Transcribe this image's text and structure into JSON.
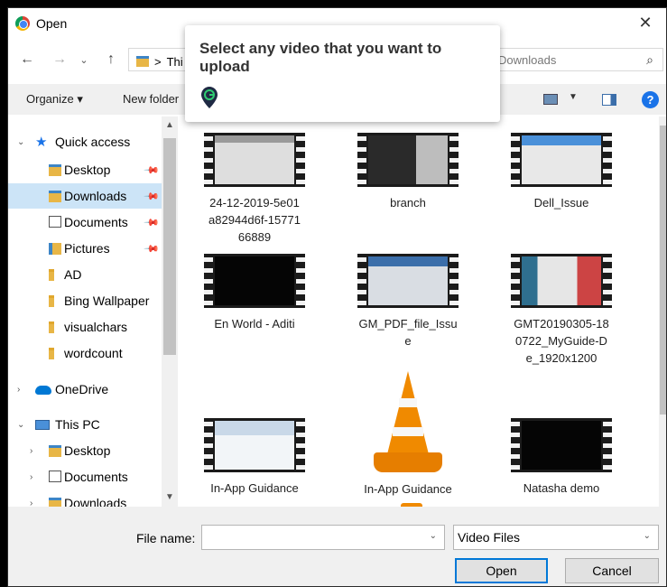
{
  "window": {
    "title": "Open",
    "close_glyph": "✕"
  },
  "address": {
    "back": "←",
    "forward": "→",
    "dropdown": "⌄",
    "up": "↑",
    "path_separator": ">",
    "path_partial": "Thi",
    "search_placeholder": "Downloads"
  },
  "toolbar": {
    "organize": "Organize ▾",
    "new_folder": "New folder",
    "help": "?"
  },
  "nav": [
    {
      "label": "Quick access",
      "icon": "star-icon"
    },
    {
      "label": "Desktop",
      "icon": "folder-icon",
      "pinned": true
    },
    {
      "label": "Downloads",
      "icon": "download-folder-icon",
      "pinned": true,
      "selected": true
    },
    {
      "label": "Documents",
      "icon": "document-icon",
      "pinned": true
    },
    {
      "label": "Pictures",
      "icon": "picture-icon",
      "pinned": true
    },
    {
      "label": "AD",
      "icon": "folder-icon"
    },
    {
      "label": "Bing Wallpaper",
      "icon": "folder-icon"
    },
    {
      "label": "visualchars",
      "icon": "folder-icon"
    },
    {
      "label": "wordcount",
      "icon": "folder-icon"
    },
    {
      "label": "OneDrive",
      "icon": "cloud-icon"
    },
    {
      "label": "This PC",
      "icon": "pc-icon"
    },
    {
      "label": "Desktop",
      "icon": "folder-icon"
    },
    {
      "label": "Documents",
      "icon": "document-icon"
    },
    {
      "label": "Downloads",
      "icon": "download-folder-icon"
    }
  ],
  "files": [
    {
      "name": "24-12-2019-5e01 a82944d6f-15771 66889",
      "lines": [
        "24-12-2019-5e01",
        "a82944d6f-15771",
        "66889"
      ],
      "kind": "video"
    },
    {
      "name": "branch",
      "lines": [
        "branch"
      ],
      "kind": "video"
    },
    {
      "name": "Dell_Issue",
      "lines": [
        "Dell_Issue"
      ],
      "kind": "video"
    },
    {
      "name": "En World - Aditi",
      "lines": [
        "En World - Aditi"
      ],
      "kind": "video"
    },
    {
      "name": "GM_PDF_file_Issue",
      "lines": [
        "GM_PDF_file_Issu",
        "e"
      ],
      "kind": "video"
    },
    {
      "name": "GMT20190305-180722_MyGuide-De_1920x1200",
      "lines": [
        "GMT20190305-18",
        "0722_MyGuide-D",
        "e_1920x1200"
      ],
      "kind": "video"
    },
    {
      "name": "In-App Guidance",
      "lines": [
        "In-App Guidance"
      ],
      "kind": "video"
    },
    {
      "name": "In-App Guidance",
      "lines": [
        "In-App Guidance"
      ],
      "kind": "vlc"
    },
    {
      "name": "Natasha demo",
      "lines": [
        "Natasha demo"
      ],
      "kind": "video"
    }
  ],
  "bottom": {
    "file_name_label": "File name:",
    "file_name_value": "",
    "file_type": "Video Files",
    "open_label": "Open",
    "cancel_label": "Cancel"
  },
  "tooltip": {
    "text": "Select any video that you want to upload",
    "logo": "guide-logo-icon"
  },
  "colors": {
    "accent": "#0078d7",
    "selected_bg": "#cce4f7",
    "toolbar_bg": "#f0f0f0"
  }
}
